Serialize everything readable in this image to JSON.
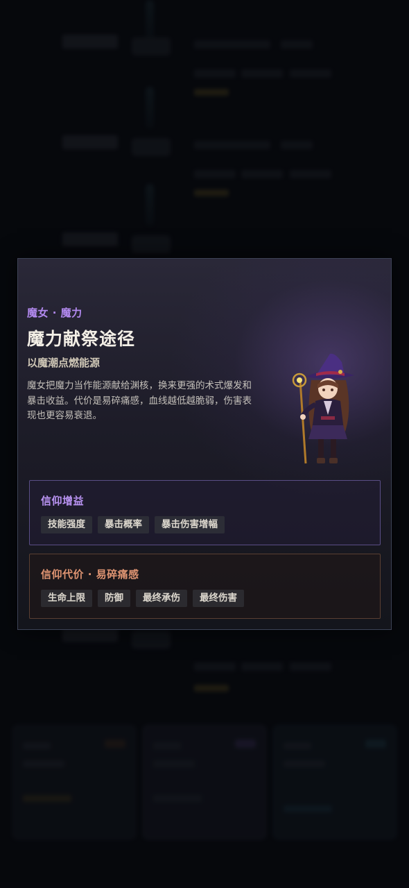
{
  "modal": {
    "eyebrow": "魔女 · 魔力",
    "title": "魔力献祭途径",
    "subtitle": "以魔潮点燃能源",
    "description": "魔女把魔力当作能源献给渊核，换来更强的术式爆发和暴击收益。代价是易碎痛感，血线越低越脆弱，伤害表现也更容易衰退。",
    "portrait_icon": "witch-portrait",
    "gain": {
      "title": "信仰增益",
      "tags": [
        "技能强度",
        "暴击概率",
        "暴击伤害增幅"
      ]
    },
    "cost": {
      "title": "信仰代价 · 易碎痛感",
      "tags": [
        "生命上限",
        "防御",
        "最终承伤",
        "最终伤害"
      ]
    }
  },
  "colors": {
    "accent_purple": "#b38af0",
    "cost_orange": "#df9472",
    "title_text": "#f3efe6"
  }
}
